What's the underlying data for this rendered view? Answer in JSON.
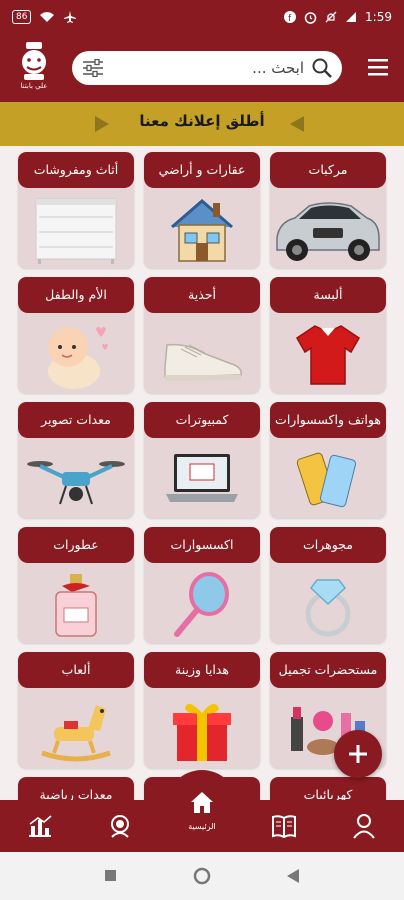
{
  "status": {
    "time": "1:59",
    "battery": "86"
  },
  "header": {
    "logo_text": "علي بابتنا",
    "search_placeholder": "ابحث ..."
  },
  "banner": {
    "text": "أطلق إعلانك معنا"
  },
  "categories": [
    {
      "label": "أثاث ومفروشات",
      "icon": "dresser-icon"
    },
    {
      "label": "عقارات و أراضي",
      "icon": "house-icon"
    },
    {
      "label": "مركبات",
      "icon": "car-icon"
    },
    {
      "label": "الأم والطفل",
      "icon": "baby-icon"
    },
    {
      "label": "أحذية",
      "icon": "shoe-icon"
    },
    {
      "label": "ألبسة",
      "icon": "shirt-icon"
    },
    {
      "label": "معدات تصوير",
      "icon": "drone-icon"
    },
    {
      "label": "كمبيوترات",
      "icon": "laptop-icon"
    },
    {
      "label": "هواتف واكسسوارات",
      "icon": "phone-icon"
    },
    {
      "label": "عطورات",
      "icon": "perfume-icon"
    },
    {
      "label": "اكسسوارات",
      "icon": "mirror-icon"
    },
    {
      "label": "مجوهرات",
      "icon": "ring-icon"
    },
    {
      "label": "ألعاب",
      "icon": "rocking-horse-icon"
    },
    {
      "label": "هدايا وزينة",
      "icon": "gift-icon"
    },
    {
      "label": "مستحضرات تجميل",
      "icon": "cosmetics-icon"
    },
    {
      "label": "معدات رياضية",
      "icon": "sports-icon"
    },
    {
      "label": "",
      "icon": ""
    },
    {
      "label": "كهربائيات",
      "icon": "appliance-icon"
    }
  ],
  "bottom_nav": {
    "home_label": "الرئيسية"
  },
  "colors": {
    "primary": "#8a1a21",
    "banner": "#c4a026",
    "card_bg": "#e5d5d6"
  }
}
